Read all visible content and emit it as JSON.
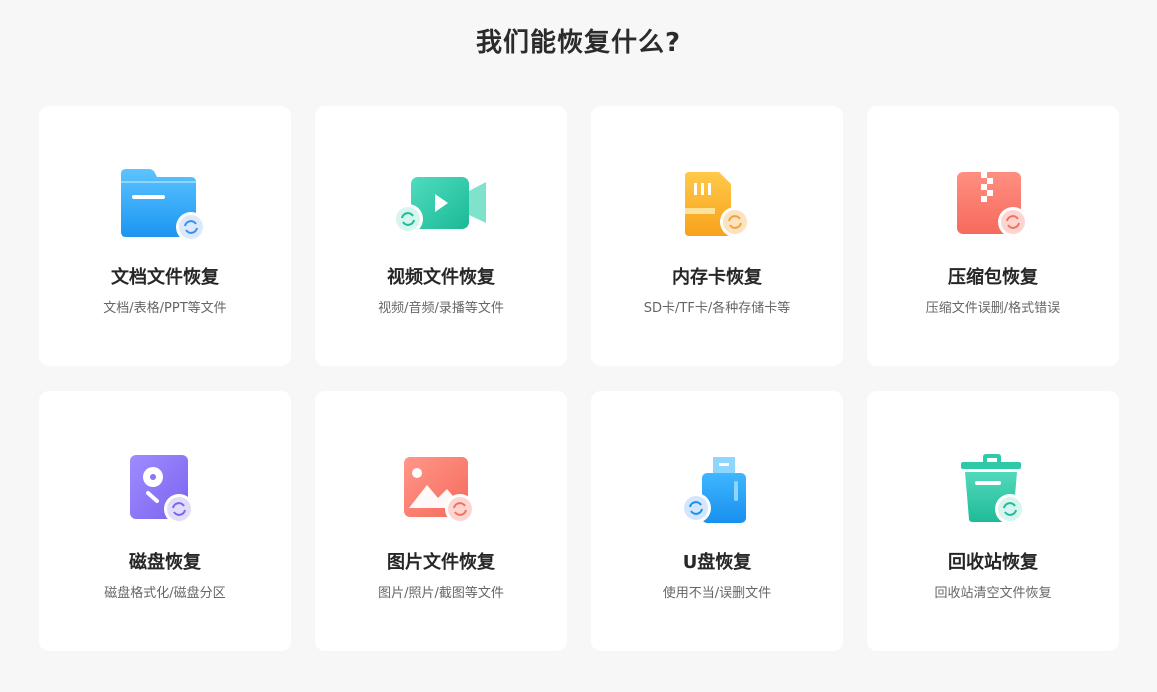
{
  "page": {
    "title": "我们能恢复什么?"
  },
  "cards": [
    {
      "title": "文档文件恢复",
      "desc": "文档/表格/PPT等文件",
      "icon": "folder-icon"
    },
    {
      "title": "视频文件恢复",
      "desc": "视频/音频/录播等文件",
      "icon": "video-camera-icon"
    },
    {
      "title": "内存卡恢复",
      "desc": "SD卡/TF卡/各种存储卡等",
      "icon": "sd-card-icon"
    },
    {
      "title": "压缩包恢复",
      "desc": "压缩文件误删/格式错误",
      "icon": "zip-archive-icon"
    },
    {
      "title": "磁盘恢复",
      "desc": "磁盘格式化/磁盘分区",
      "icon": "hard-disk-icon"
    },
    {
      "title": "图片文件恢复",
      "desc": "图片/照片/截图等文件",
      "icon": "image-icon"
    },
    {
      "title": "U盘恢复",
      "desc": "使用不当/误删文件",
      "icon": "usb-drive-icon"
    },
    {
      "title": "回收站恢复",
      "desc": "回收站清空文件恢复",
      "icon": "recycle-bin-icon"
    }
  ],
  "colors": {
    "folder": "#2fa8f8",
    "video": "#2ec9a8",
    "sd_card": "#f8b12c",
    "zip": "#fb7e72",
    "disk": "#8c74f2",
    "image": "#fb7e72",
    "usb": "#2f9ff2",
    "recycle": "#2ec9a8",
    "background": "#f7f7f8"
  }
}
